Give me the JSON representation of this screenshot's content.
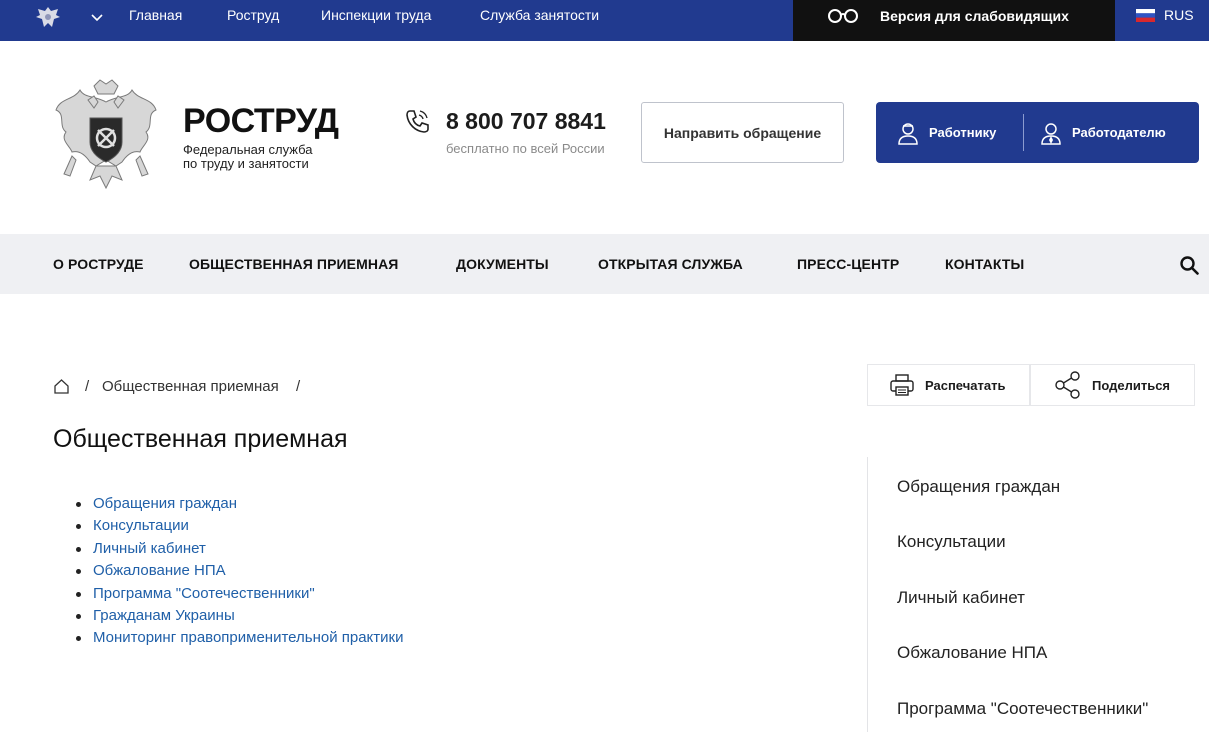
{
  "topbar": {
    "nav": [
      "Главная",
      "Роструд",
      "Инспекции труда",
      "Служба занятости"
    ],
    "vision_label": "Версия для слабовидящих",
    "lang_label": "RUS"
  },
  "header": {
    "brand_title": "РОСТРУД",
    "brand_sub_line1": "Федеральная служба",
    "brand_sub_line2": "по труду и занятости",
    "phone": "8 800 707 8841",
    "phone_note": "бесплатно по всей России",
    "appeal_button": "Направить обращение",
    "employee_button": "Работнику",
    "employer_button": "Работодателю"
  },
  "mainnav": [
    "О РОСТРУДЕ",
    "ОБЩЕСТВЕННАЯ ПРИЕМНАЯ",
    "ДОКУМЕНТЫ",
    "ОТКРЫТАЯ СЛУЖБА",
    "ПРЕСС-ЦЕНТР",
    "КОНТАКТЫ"
  ],
  "breadcrumb": {
    "sep": "/",
    "current": "Общественная приемная"
  },
  "tools": {
    "print": "Распечатать",
    "share": "Поделиться"
  },
  "page_title": "Общественная приемная",
  "links": [
    "Обращения граждан",
    "Консультации",
    "Личный кабинет",
    "Обжалование НПА",
    "Программа \"Соотечественники\"",
    "Гражданам Украины",
    "Мониторинг правоприменительной практики"
  ],
  "side_menu": [
    "Обращения граждан",
    "Консультации",
    "Личный кабинет",
    "Обжалование НПА",
    "Программа \"Соотечественники\""
  ],
  "colors": {
    "brand_blue": "#213a8f",
    "link_blue": "#1f5fa8",
    "nav_bg": "#eff0f3"
  }
}
